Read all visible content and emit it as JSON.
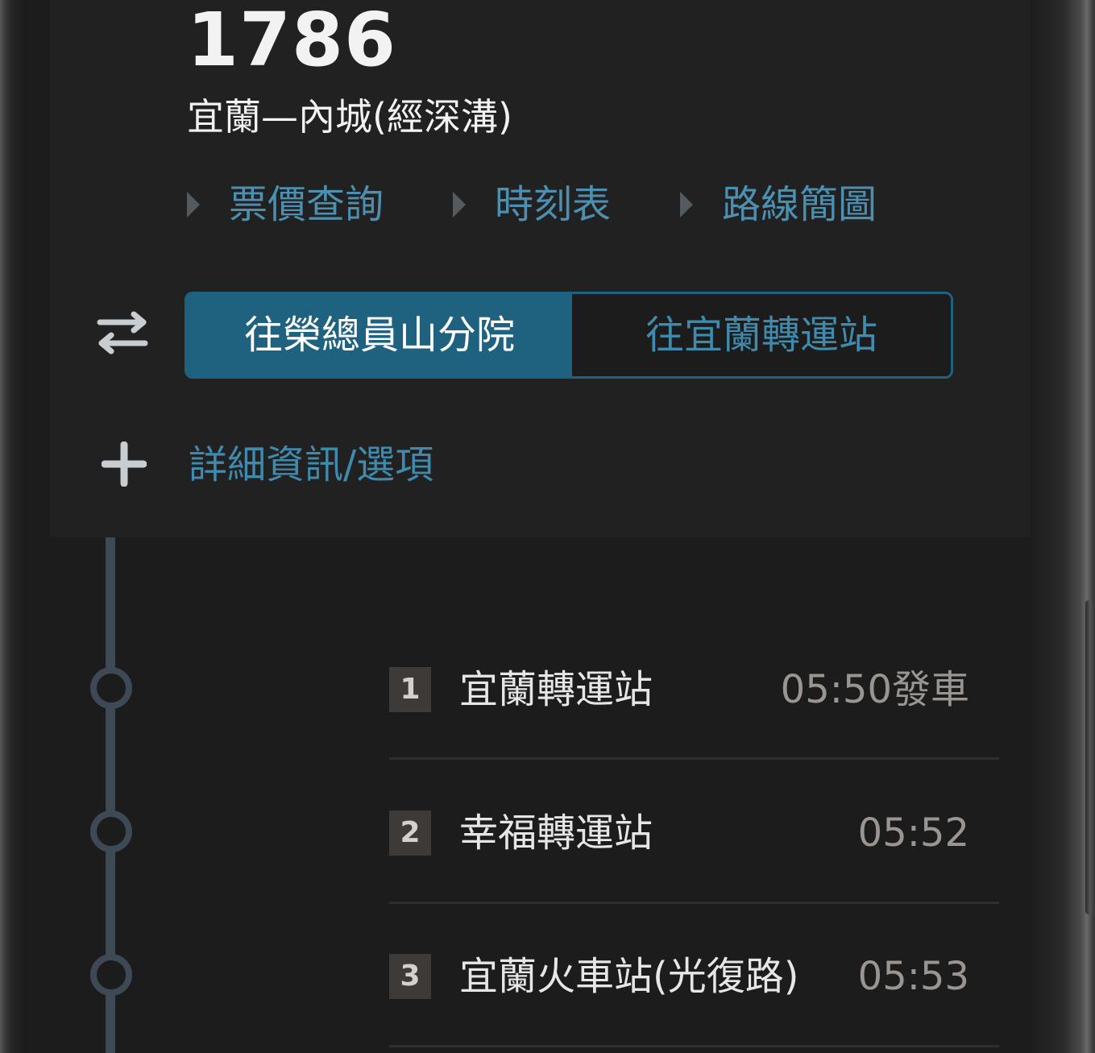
{
  "route": {
    "number": "1786",
    "name": "宜蘭—內城(經深溝)"
  },
  "links": {
    "fare": "票價查詢",
    "timetable": "時刻表",
    "map": "路線簡圖"
  },
  "direction": {
    "active_label": "往榮總員山分院",
    "inactive_label": "往宜蘭轉運站"
  },
  "details": {
    "label": "詳細資訊/選項"
  },
  "stops": [
    {
      "index": "1",
      "name": "宜蘭轉運站",
      "time": "05:50發車"
    },
    {
      "index": "2",
      "name": "幸福轉運站",
      "time": "05:52"
    },
    {
      "index": "3",
      "name": "宜蘭火車站(光復路)",
      "time": "05:53"
    }
  ],
  "colors": {
    "accent": "#1f6280",
    "link": "#4c8fb0",
    "timeline": "#3d4a55"
  }
}
